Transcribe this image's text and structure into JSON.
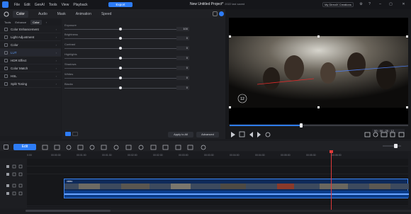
{
  "app": {
    "menu": [
      "File",
      "Edit",
      "GenAI",
      "Tools",
      "View",
      "Playback"
    ],
    "export_label": "Export",
    "project_title": "New Untitled Project*",
    "project_sub": "2022 last saved",
    "account_label": "My DirectX Creations"
  },
  "panel": {
    "tabs": [
      "Color",
      "Audio",
      "Mask",
      "Animation",
      "Speed"
    ],
    "active_tab": "Color",
    "subtabs": [
      "Tools",
      "Enhance",
      "Color"
    ],
    "active_subtab": "Color"
  },
  "features": [
    {
      "label": "Color Enhancement"
    },
    {
      "label": "Light Adjustment"
    },
    {
      "label": "Color"
    },
    {
      "label": "LUT"
    },
    {
      "label": "HDR Effect"
    },
    {
      "label": "Color Match"
    },
    {
      "label": "HSL"
    },
    {
      "label": "Split Toning"
    }
  ],
  "adjustments": {
    "sliders": [
      {
        "name": "Exposure",
        "value": "100",
        "level": 0.5
      },
      {
        "name": "Brightness",
        "value": "0",
        "level": 0.5
      },
      {
        "name": "Contrast",
        "value": "0",
        "level": 0.5
      },
      {
        "name": "Highlights",
        "value": "0",
        "level": 0.5
      },
      {
        "name": "Shadows",
        "value": "0",
        "level": 0.5
      },
      {
        "name": "Whites",
        "value": "0",
        "level": 0.5
      },
      {
        "name": "Blacks",
        "value": "0",
        "level": 0.5
      }
    ],
    "apply_all_label": "Apply to All",
    "advanced_label": "Advanced"
  },
  "preview": {
    "time": "00 : 00 : 25 : 12",
    "progress": 0.4,
    "watermark_label": "12"
  },
  "timeline": {
    "edit_label": "Edit",
    "ticks": [
      "0:00",
      "00:00:30",
      "00:01:00",
      "00:01:30",
      "00:02:00",
      "00:02:30",
      "00:03:00",
      "00:03:30",
      "00:04:00",
      "00:04:30",
      "00:05:00",
      "00:05:30",
      "00:06:00"
    ],
    "clip_label": "video",
    "playhead_fraction": 0.8
  }
}
